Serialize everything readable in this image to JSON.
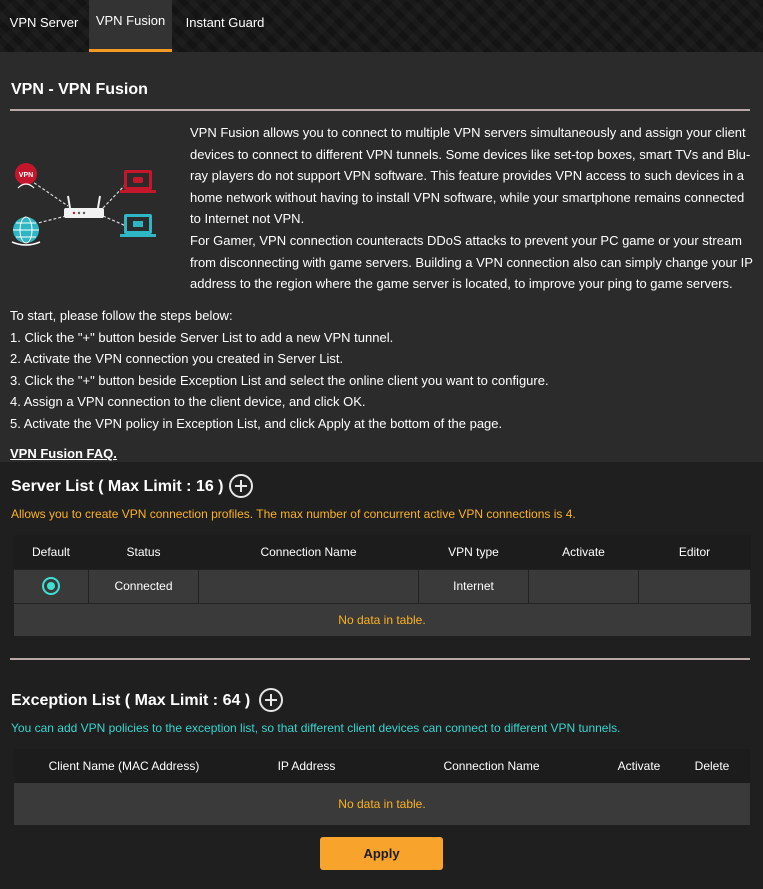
{
  "tabs": [
    {
      "label": "VPN Server",
      "active": false
    },
    {
      "label": "VPN Fusion",
      "active": true
    },
    {
      "label": "Instant Guard",
      "active": false
    }
  ],
  "page": {
    "title": "VPN - VPN Fusion",
    "intro_p1": "VPN Fusion allows you to connect to multiple VPN servers simultaneously and assign your client devices to connect to different VPN tunnels. Some devices like set-top boxes, smart TVs and Blu-ray players do not support VPN software. This feature provides VPN access to such devices in a home network without having to install VPN software, while your smartphone remains connected to Internet not VPN.",
    "intro_p2": "For Gamer, VPN connection counteracts DDoS attacks to prevent your PC game or your stream from disconnecting with game servers. Building a VPN connection also can simply change your IP address to the region where the game server is located, to improve your ping to game servers.",
    "illustration_badge": "VPN",
    "steps_intro": "To start, please follow the steps below:",
    "steps": [
      "1. Click the \"+\" button beside Server List to add a new VPN tunnel.",
      "2. Activate the VPN connection you created in Server List.",
      "3. Click the \"+\" button beside Exception List and select the online client you want to configure.",
      "4. Assign a VPN connection to the client device, and click OK.",
      "5. Activate the VPN policy in Exception List, and click Apply at the bottom of the page."
    ],
    "faq_link": "VPN Fusion FAQ."
  },
  "server_list": {
    "title": "Server List ( Max Limit : 16 )",
    "note": "Allows you to create VPN connection profiles. The max number of concurrent active VPN connections is 4.",
    "columns": [
      "Default",
      "Status",
      "Connection Name",
      "VPN type",
      "Activate",
      "Editor"
    ],
    "row": {
      "status": "Connected",
      "connection_name": "",
      "vpn_type": "Internet",
      "activate": "",
      "editor": ""
    },
    "empty_text": "No data in table."
  },
  "exception_list": {
    "title": "Exception List ( Max Limit : 64 )",
    "note": "You can add VPN policies to the exception list, so that different client devices can connect to different VPN tunnels.",
    "columns": [
      "Client Name (MAC Address)",
      "IP Address",
      "Connection Name",
      "Activate",
      "Delete"
    ],
    "empty_text": "No data in table."
  },
  "apply_label": "Apply",
  "colors": {
    "accent": "#f29a21",
    "note_orange": "#fcb322",
    "note_cyan": "#36d6cf",
    "radio": "#3ee0d4",
    "apply": "#f8a32b"
  }
}
